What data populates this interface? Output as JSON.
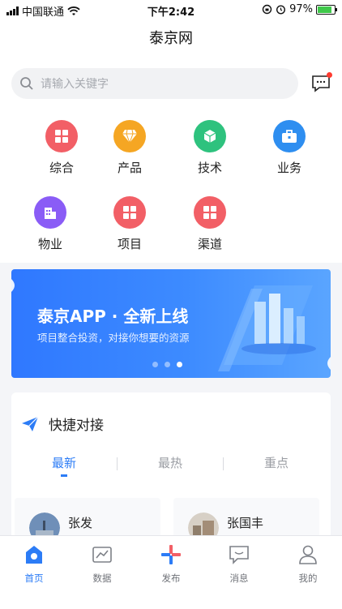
{
  "status": {
    "carrier": "中国联通",
    "time": "下午2:42",
    "battery": "97%"
  },
  "nav": {
    "title": "泰京网"
  },
  "search": {
    "placeholder": "请输入关键字"
  },
  "categories": [
    {
      "label": "综合",
      "icon": "grid-icon",
      "color": "#f25f66"
    },
    {
      "label": "产品",
      "icon": "diamond-icon",
      "color": "#f5a623"
    },
    {
      "label": "技术",
      "icon": "cube-icon",
      "color": "#2ec27e"
    },
    {
      "label": "业务",
      "icon": "briefcase-icon",
      "color": "#2e8ef0"
    },
    {
      "label": "物业",
      "icon": "building-icon",
      "color": "#8a5cf6"
    },
    {
      "label": "项目",
      "icon": "grid-icon",
      "color": "#f25f66"
    },
    {
      "label": "渠道",
      "icon": "grid-icon",
      "color": "#f25f66"
    }
  ],
  "banner": {
    "title": "泰京APP · 全新上线",
    "subtitle": "项目整合投资，对接你想要的资源",
    "active_index": 2,
    "total": 3
  },
  "quick": {
    "title": "快捷对接",
    "tabs": [
      "最新",
      "最热",
      "重点"
    ],
    "cards": [
      {
        "name": "张发"
      },
      {
        "name": "张国丰"
      }
    ]
  },
  "tabbar": [
    {
      "label": "首页",
      "icon": "home-icon",
      "active": true
    },
    {
      "label": "数据",
      "icon": "chart-icon",
      "active": false
    },
    {
      "label": "发布",
      "icon": "plus-icon",
      "active": false
    },
    {
      "label": "消息",
      "icon": "chat-icon",
      "active": false
    },
    {
      "label": "我的",
      "icon": "user-icon",
      "active": false
    }
  ],
  "colors": {
    "accent": "#2c7cf6",
    "badge": "#ff3b30"
  }
}
